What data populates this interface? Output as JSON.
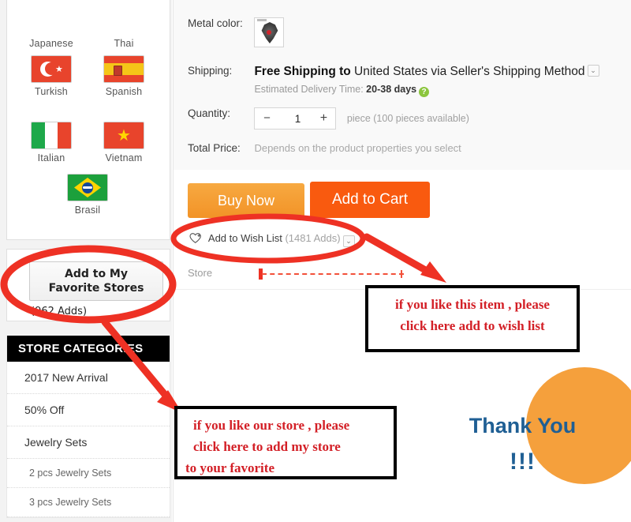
{
  "sidebar": {
    "languages": [
      {
        "label": "Japanese",
        "flag": "japan-flag",
        "row": 0,
        "col": 0
      },
      {
        "label": "Thai",
        "flag": "thailand-flag",
        "row": 0,
        "col": 1
      },
      {
        "label": "Turkish",
        "flag": "turkey-flag",
        "row": 1,
        "col": 0
      },
      {
        "label": "Spanish",
        "flag": "spain-flag",
        "row": 1,
        "col": 1
      },
      {
        "label": "Italian",
        "flag": "italy-flag",
        "row": 2,
        "col": 0
      },
      {
        "label": "Vietnam",
        "flag": "vietnam-flag",
        "row": 2,
        "col": 1
      },
      {
        "label": "Brasil",
        "flag": "brazil-flag",
        "row": 3,
        "col": 0
      }
    ],
    "favorite": {
      "button_label_line1": "Add to My",
      "button_label_line2": "Favorite Stores",
      "adds": "(962 Adds)"
    },
    "categories": {
      "header": "STORE CATEGORIES",
      "items": [
        {
          "label": "2017 New Arrival",
          "sub": false
        },
        {
          "label": "50% Off",
          "sub": false
        },
        {
          "label": "Jewelry Sets",
          "sub": false
        },
        {
          "label": "2 pcs Jewelry Sets",
          "sub": true
        },
        {
          "label": "3 pcs Jewelry Sets",
          "sub": true
        }
      ]
    }
  },
  "product": {
    "metal_color": {
      "label": "Metal color:",
      "swatch_name": "ornate-pendant-thumbnail"
    },
    "shipping": {
      "label": "Shipping:",
      "free_text": "Free Shipping to",
      "rest_text": " United States via Seller's Shipping Method",
      "caret": "⌄",
      "estimate_prefix": "Estimated Delivery Time: ",
      "estimate_value": "20-38 days",
      "help_glyph": "?"
    },
    "quantity": {
      "label": "Quantity:",
      "minus": "−",
      "plus": "+",
      "value": "1",
      "note": "piece (100 pieces available)"
    },
    "total_price": {
      "label": "Total Price:",
      "note": "Depends on the product properties you select"
    },
    "buy_now_label": "Buy Now",
    "add_to_cart_label": "Add to Cart",
    "wish_list": {
      "label": "Add to Wish List",
      "count": " (1481 Adds)",
      "caret": "⌄",
      "icon": "heart-plus-icon"
    },
    "store_label": "Store"
  },
  "annotations": {
    "wish_note": {
      "line1": "if  you like this item , please",
      "line2": "click here add to wish list"
    },
    "store_note": {
      "line1": "if  you like our store , please",
      "line2": "click here to add my store",
      "line3": "to your favorite"
    },
    "thank_you": {
      "text": "Thank You",
      "bang": "!!!"
    }
  },
  "colors": {
    "annotation_red": "#d31f26",
    "marker_red": "#ee3124",
    "buy_now_orange": "#f29327",
    "add_cart_orange": "#f95a0f",
    "starburst_orange": "#f5a03c",
    "starburst_shadow": "#b7402c",
    "thankyou_blue": "#1f5f94",
    "category_header_bg": "#000000"
  }
}
